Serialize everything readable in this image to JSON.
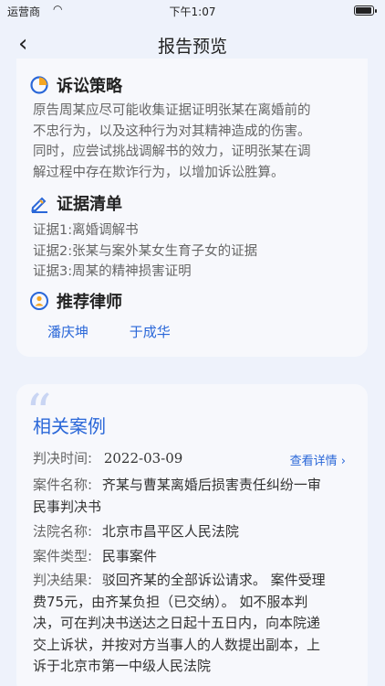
{
  "status": {
    "carrier": "运营商",
    "time": "下午1:07"
  },
  "nav": {
    "title": "报告预览",
    "back_symbol": "‹"
  },
  "strategy": {
    "title": "诉讼策略",
    "lines": [
      "原告周某应尽可能收集证据证明张某在离婚前的",
      "不忠行为，以及这种行为对其精神造成的伤害。",
      "同时，应尝试挑战调解书的效力，证明张某在调",
      "解过程中存在欺诈行为，以增加诉讼胜算。"
    ]
  },
  "evidence": {
    "title": "证据清单",
    "items": [
      "证据1:离婚调解书",
      "证据2:张某与案外某女生育子女的证据",
      "证据3:周某的精神损害证明"
    ]
  },
  "lawyers": {
    "title": "推荐律师",
    "names": [
      "潘庆坤",
      "于成华"
    ]
  },
  "cases": {
    "title": "相关案例",
    "detail_link": "查看详情 ›",
    "judgment_date_label": "判决时间:",
    "judgment_date": "2022-03-09",
    "case_name_label": "案件名称:",
    "case_name_line1": "齐某与曹某离婚后损害责任纠纷一审",
    "case_name_line2": "民事判决书",
    "court_label": "法院名称:",
    "court": "北京市昌平区人民法院",
    "type_label": "案件类型:",
    "type": "民事案件",
    "result_label": "判决结果:",
    "result_line1": "驳回齐某的全部诉讼请求。 案件受理",
    "result_lines": [
      "费75元，由齐某负担（已交纳）。 如不服本判",
      "决，可在判决书送达之日起十五日内，向本院递",
      "交上诉状，并按对方当事人的人数提出副本，上",
      "诉于北京市第一中级人民法院"
    ]
  },
  "colors": {
    "accent": "#2a67d8",
    "background": "#eef2fb",
    "card": "#f7f8fc"
  }
}
